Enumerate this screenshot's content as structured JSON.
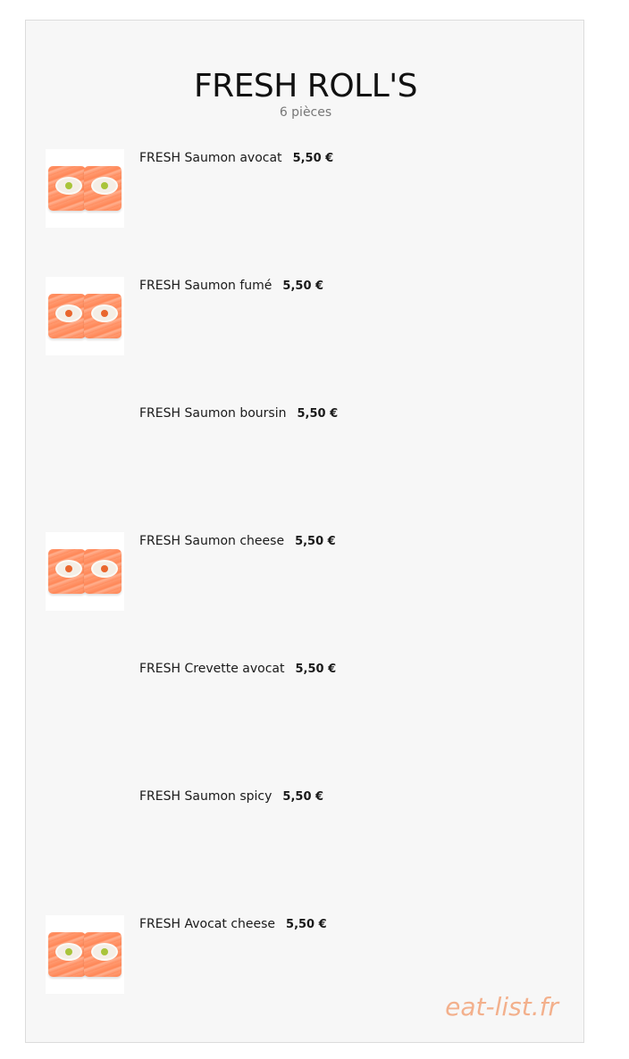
{
  "menu": {
    "title": "FRESH ROLL'S",
    "subtitle": "6 pièces",
    "items": [
      {
        "name": "FRESH Saumon avocat",
        "price": "5,50 €",
        "has_image": true,
        "filling": "green"
      },
      {
        "name": "FRESH Saumon fumé",
        "price": "5,50 €",
        "has_image": true,
        "filling": "orange"
      },
      {
        "name": "FRESH Saumon boursin",
        "price": "5,50 €",
        "has_image": false
      },
      {
        "name": "FRESH Saumon cheese",
        "price": "5,50 €",
        "has_image": true,
        "filling": "orange"
      },
      {
        "name": "FRESH Crevette avocat",
        "price": "5,50 €",
        "has_image": false
      },
      {
        "name": "FRESH Saumon spicy",
        "price": "5,50 €",
        "has_image": false
      },
      {
        "name": "FRESH Avocat cheese",
        "price": "5,50 €",
        "has_image": true,
        "filling": "green"
      }
    ]
  },
  "watermark": "eat-list.fr",
  "colors": {
    "panel_background": "#f7f7f7",
    "salmon": "#ff8b5d",
    "watermark": "#f3b08c"
  }
}
